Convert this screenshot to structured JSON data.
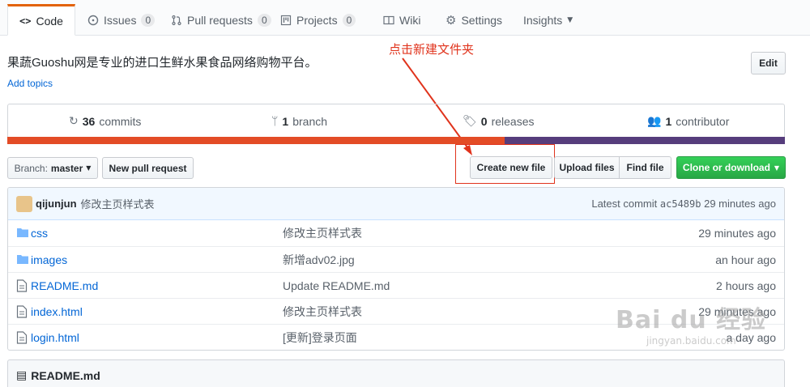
{
  "tabs": [
    {
      "label": "Code",
      "icon": "code-icon"
    },
    {
      "label": "Issues",
      "count": "0",
      "icon": "issue-icon"
    },
    {
      "label": "Pull requests",
      "count": "0",
      "icon": "pr-icon"
    },
    {
      "label": "Projects",
      "count": "0",
      "icon": "project-icon"
    },
    {
      "label": "Wiki",
      "icon": "book-icon"
    },
    {
      "label": "Settings",
      "icon": "gear-icon"
    },
    {
      "label": "Insights",
      "icon": "chevron-down-icon"
    }
  ],
  "repo": {
    "description": "果蔬Guoshu网是专业的进口生鲜水果食品网络购物平台。",
    "add_topics": "Add topics",
    "edit_label": "Edit"
  },
  "annotation": "点击新建文件夹",
  "summary": {
    "commits_count": "36",
    "commits_label": "commits",
    "branch_count": "1",
    "branch_label": "branch",
    "releases_count": "0",
    "releases_label": "releases",
    "contributor_count": "1",
    "contributor_label": "contributor"
  },
  "language_colors": [
    "#e34c26",
    "#563d7c"
  ],
  "actions": {
    "branch_prefix": "Branch:",
    "branch_name": "master",
    "new_pull_request": "New pull request",
    "create_new_file": "Create new file",
    "upload_files": "Upload files",
    "find_file": "Find file",
    "clone_or_download": "Clone or download"
  },
  "commit": {
    "author": "qijunjun",
    "message": "修改主页样式表",
    "latest_label": "Latest commit",
    "sha": "ac5489b",
    "age": "29 minutes ago"
  },
  "files": [
    {
      "name": "css",
      "type": "dir",
      "message": "修改主页样式表",
      "age": "29 minutes ago"
    },
    {
      "name": "images",
      "type": "dir",
      "message": "新增adv02.jpg",
      "age": "an hour ago"
    },
    {
      "name": "README.md",
      "type": "file",
      "message": "Update README.md",
      "age": "2 hours ago"
    },
    {
      "name": "index.html",
      "type": "file",
      "message": "修改主页样式表",
      "age": "29 minutes ago"
    },
    {
      "name": "login.html",
      "type": "file",
      "message": "[更新]登录页面",
      "age": "a day ago"
    }
  ],
  "readme_title": "README.md",
  "watermark": {
    "brand": "Bai du 经验",
    "url": "jingyan.baidu.com"
  },
  "colors": {
    "accent_orange": "#e36209",
    "link_blue": "#0366d6",
    "clone_green": "#28a745",
    "annotation_red": "#e0331c"
  }
}
